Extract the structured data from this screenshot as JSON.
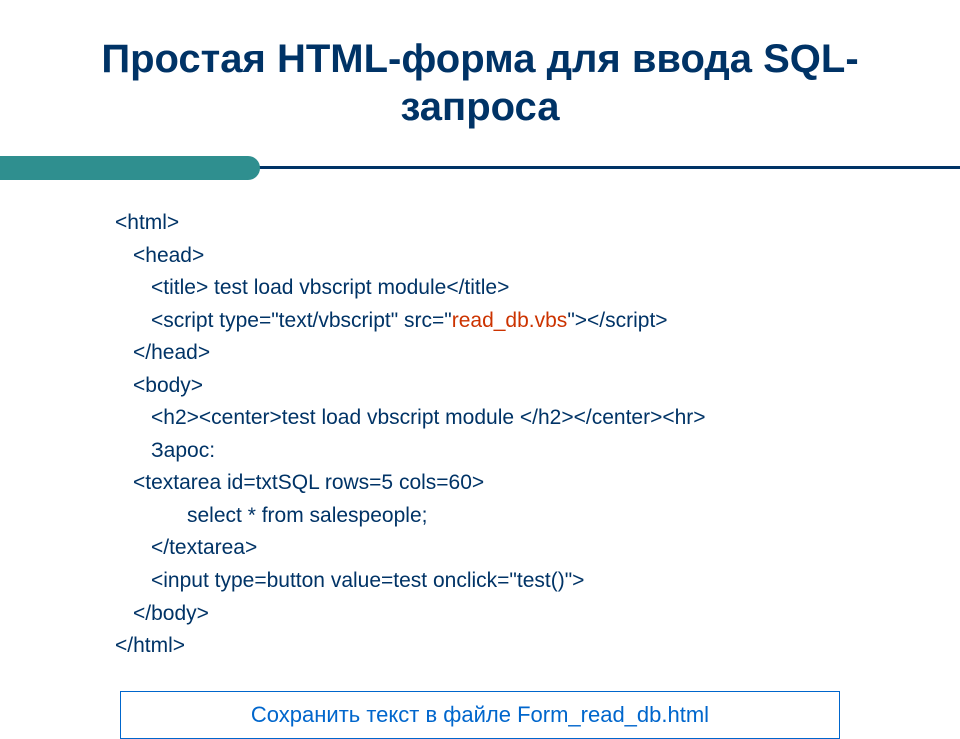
{
  "title": "Простая HTML-форма для ввода SQL-запроса",
  "code": {
    "l1": "<html>",
    "l2": "<head>",
    "l3a": "<title> test load vbscript module</title>",
    "l4a": "<script type=\"text/vbscript\" src=\"",
    "l4b": "read_db.vbs",
    "l4c": "\"></script>",
    "l5": "</head>",
    "l6": "<body>",
    "l7": "<h2><center>test load vbscript module </h2></center><hr>",
    "l8": "Зарос:",
    "l9": "<textarea id=txtSQL rows=5 cols=60>",
    "l10": "select * from salespeople;",
    "l11": "</textarea>",
    "l12": "<input type=button value=test onclick=\"test()\">",
    "l13": "</body>",
    "l14": "</html>"
  },
  "footer": "Сохранить текст в файле Form_read_db.html"
}
